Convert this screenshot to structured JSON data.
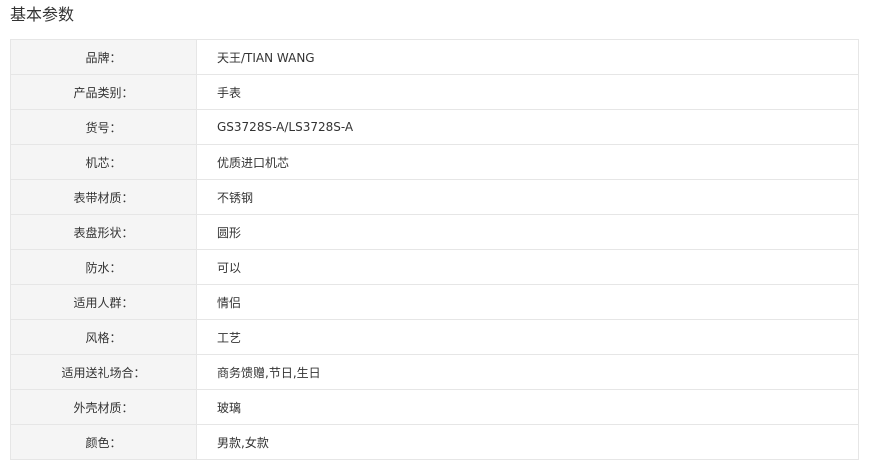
{
  "section_title": "基本参数",
  "specs": [
    {
      "label": "品牌：",
      "value": "天王/TIAN WANG"
    },
    {
      "label": "产品类别：",
      "value": "手表"
    },
    {
      "label": "货号：",
      "value": "GS3728S-A/LS3728S-A"
    },
    {
      "label": "机芯：",
      "value": "优质进口机芯"
    },
    {
      "label": "表带材质：",
      "value": "不锈钢"
    },
    {
      "label": "表盘形状：",
      "value": "圆形"
    },
    {
      "label": "防水：",
      "value": "可以"
    },
    {
      "label": "适用人群：",
      "value": "情侣"
    },
    {
      "label": "风格：",
      "value": "工艺"
    },
    {
      "label": "适用送礼场合：",
      "value": "商务馈赠,节日,生日"
    },
    {
      "label": "外壳材质：",
      "value": "玻璃"
    },
    {
      "label": "颜色：",
      "value": "男款,女款"
    }
  ]
}
